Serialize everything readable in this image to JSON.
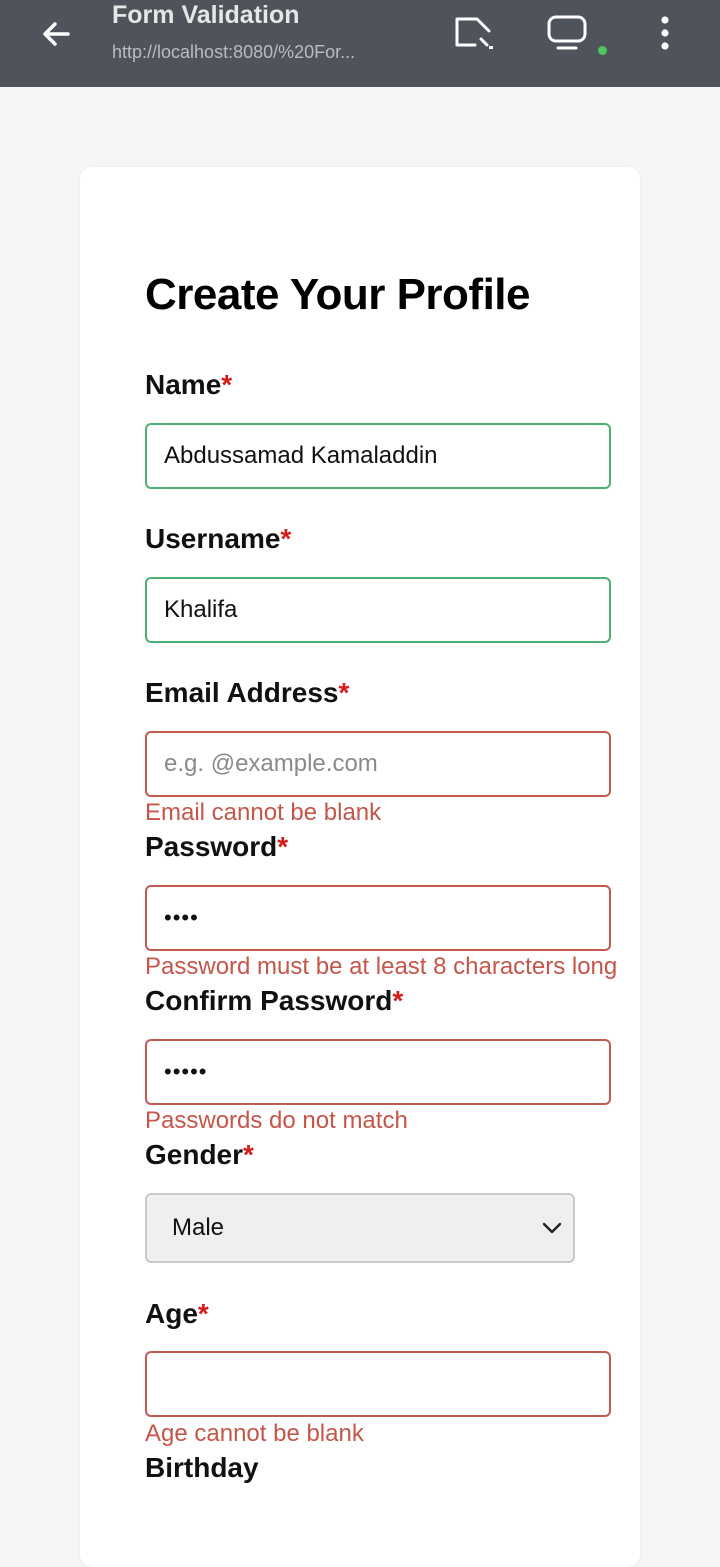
{
  "browser": {
    "title": "Form Validation",
    "url": "http://localhost:8080/%20For..."
  },
  "form": {
    "heading": "Create Your Profile",
    "required_mark": "*",
    "fields": {
      "name": {
        "label": "Name",
        "value": "Abdussamad Kamaladdin"
      },
      "username": {
        "label": "Username",
        "value": "Khalifa"
      },
      "email": {
        "label": "Email Address",
        "placeholder": "e.g. @example.com",
        "value": "",
        "error": "Email cannot be blank"
      },
      "password": {
        "label": "Password",
        "value": "••••",
        "error": "Password must be at least 8 characters long"
      },
      "confirm_password": {
        "label": "Confirm Password",
        "value": "•••••",
        "error": "Passwords do not match"
      },
      "gender": {
        "label": "Gender",
        "selected": "Male"
      },
      "age": {
        "label": "Age",
        "value": "",
        "error": "Age cannot be blank"
      },
      "birthday": {
        "label": "Birthday"
      }
    }
  },
  "colors": {
    "topbar": "#4f535c",
    "valid_border": "#4caf73",
    "invalid_border": "#c25a50",
    "error_text": "#c6554a",
    "required": "#d61b1b"
  },
  "icons": [
    "back-arrow-icon",
    "cast-icon",
    "tab-switcher-icon",
    "more-vertical-icon",
    "chevron-down-icon"
  ]
}
